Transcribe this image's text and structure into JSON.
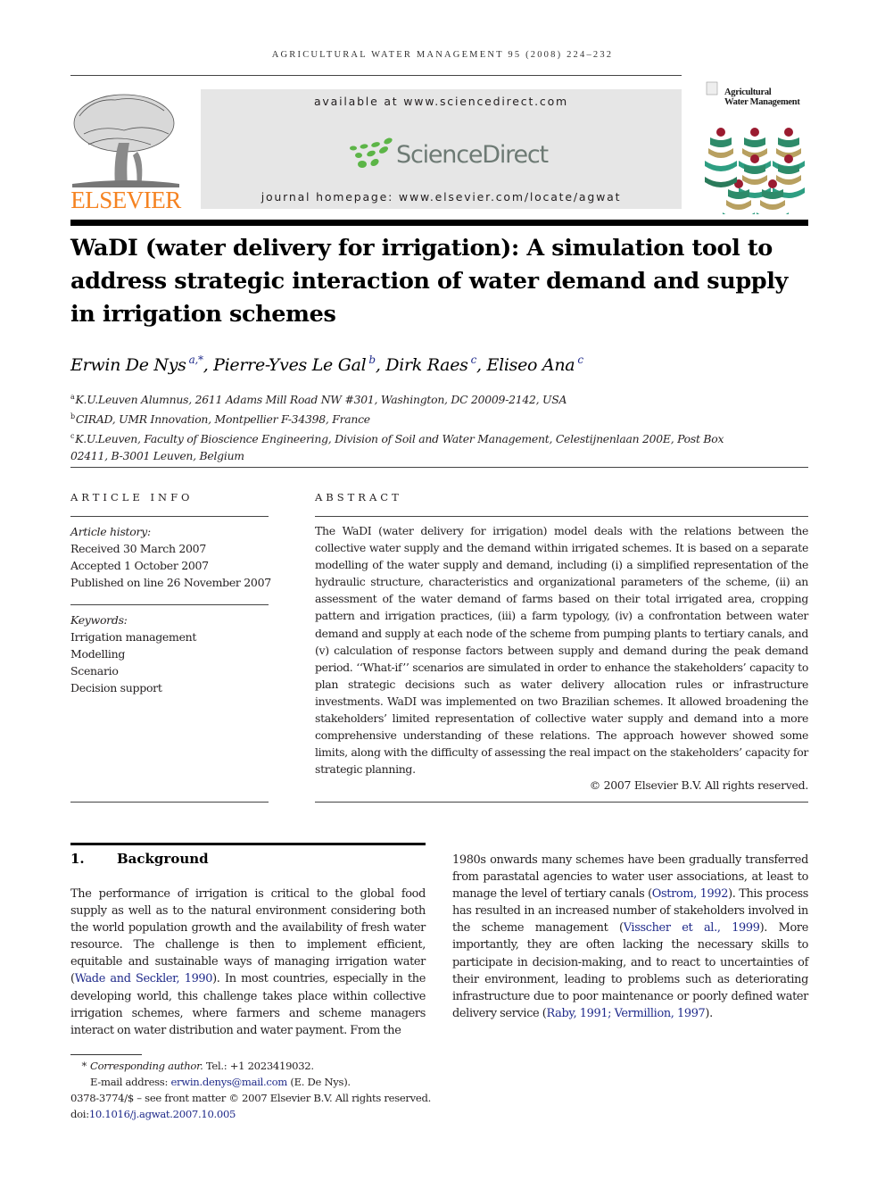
{
  "header": {
    "running_head": "AGRICULTURAL WATER MANAGEMENT 95 (2008) 224–232",
    "publisher": "ELSEVIER",
    "available_at": "available at www.sciencedirect.com",
    "sciencedirect_wordmark": "ScienceDirect",
    "journal_homepage": "journal homepage: www.elsevier.com/locate/agwat",
    "cover_title_line1": "Agricultural",
    "cover_title_line2": "Water Management",
    "colors": {
      "elsevier_orange": "#f58220",
      "sciencedirect_green": "#5cb547",
      "sciencedirect_gray": "#6d7a74",
      "panel_gray": "#e6e6e6",
      "link_blue": "#1f2a8a"
    }
  },
  "article": {
    "title": "WaDI (water delivery for irrigation): A simulation tool to address strategic interaction of water demand and supply in irrigation schemes",
    "authors": [
      {
        "name": "Erwin De Nys",
        "sup": "a,*"
      },
      {
        "name": "Pierre-Yves Le Gal",
        "sup": "b"
      },
      {
        "name": "Dirk Raes",
        "sup": "c"
      },
      {
        "name": "Eliseo Ana",
        "sup": "c"
      }
    ],
    "affiliations": [
      {
        "key": "a",
        "text": "K.U.Leuven Alumnus, 2611 Adams Mill Road NW #301, Washington, DC 20009-2142, USA"
      },
      {
        "key": "b",
        "text": "CIRAD, UMR Innovation, Montpellier F-34398, France"
      },
      {
        "key": "c",
        "text": "K.U.Leuven, Faculty of Bioscience Engineering, Division of Soil and Water Management, Celestijnenlaan 200E, Post Box 02411, B-3001 Leuven, Belgium"
      }
    ]
  },
  "article_info": {
    "label": "ARTICLE INFO",
    "history_label": "Article history:",
    "history": [
      "Received 30 March 2007",
      "Accepted 1 October 2007",
      "Published on line 26 November 2007"
    ],
    "keywords_label": "Keywords:",
    "keywords": [
      "Irrigation management",
      "Modelling",
      "Scenario",
      "Decision support"
    ]
  },
  "abstract": {
    "label": "ABSTRACT",
    "text": "The WaDI (water delivery for irrigation) model deals with the relations between the collective water supply and the demand within irrigated schemes. It is based on a separate modelling of the water supply and demand, including (i) a simplified representation of the hydraulic structure, characteristics and organizational parameters of the scheme, (ii) an assessment of the water demand of farms based on their total irrigated area, cropping pattern and irrigation practices, (iii) a farm typology, (iv) a confrontation between water demand and supply at each node of the scheme from pumping plants to tertiary canals, and (v) calculation of response factors between supply and demand during the peak demand period. ‘‘What-if’’ scenarios are simulated in order to enhance the stakeholders’ capacity to plan strategic decisions such as water delivery allocation rules or infrastructure investments. WaDI was implemented on two Brazilian schemes. It allowed broadening the stakeholders’ limited representation of collective water supply and demand into a more comprehensive understanding of these relations. The approach however showed some limits, along with the difficulty of assessing the real impact on the stakeholders’ capacity for strategic planning.",
    "copyright": "© 2007 Elsevier B.V. All rights reserved."
  },
  "section1": {
    "number": "1.",
    "heading": "Background",
    "left": {
      "p1": "The performance of irrigation is critical to the global food supply as well as to the natural environment considering both the world population growth and the availability of fresh water resource. The challenge is then to implement efficient, equitable and sustainable ways of managing irrigation water (",
      "cite1": "Wade and Seckler, 1990",
      "p2": "). In most countries, especially in the developing world, this challenge takes place within collective irrigation schemes, where farmers and scheme managers interact on water distribution and water payment. From the"
    },
    "right": {
      "p1": "1980s onwards many schemes have been gradually transferred from parastatal agencies to water user associations, at least to manage the level of tertiary canals (",
      "cite1": "Ostrom, 1992",
      "p2": "). This process has resulted in an increased number of stakeholders involved in the scheme management (",
      "cite2": "Visscher et al., 1999",
      "p3": "). More importantly, they are often lacking the necessary skills to participate in decision-making, and to react to uncertainties of their environment, leading to problems such as deteriorating infrastructure due to poor maintenance or poorly defined water delivery service (",
      "cite3": "Raby, 1991; Vermillion, 1997",
      "p4": ")."
    }
  },
  "footnotes": {
    "star": "*",
    "corresponding_label": "Corresponding author.",
    "tel": " Tel.: +1 2023419032.",
    "email_label": "E-mail address: ",
    "email": "erwin.denys@mail.com",
    "email_suffix": " (E. De Nys).",
    "issn_line": "0378-3774/$ – see front matter © 2007 Elsevier B.V. All rights reserved.",
    "doi_label": "doi:",
    "doi": "10.1016/j.agwat.2007.10.005"
  }
}
